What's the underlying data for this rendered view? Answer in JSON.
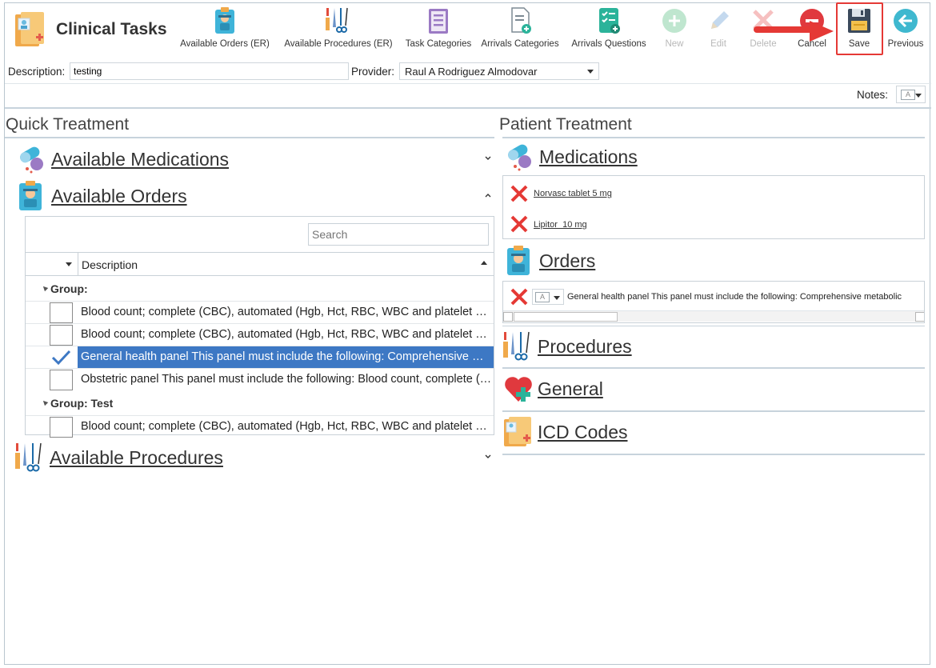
{
  "app": {
    "title": "Clinical Tasks"
  },
  "toolbar": {
    "buttons": [
      {
        "id": "available-orders-er",
        "label": "Available Orders (ER)",
        "icon": "orders-clipboard-icon",
        "enabled": true
      },
      {
        "id": "available-procedures-er",
        "label": "Available Procedures (ER)",
        "icon": "surgical-tools-icon",
        "enabled": true
      },
      {
        "id": "task-categories",
        "label": "Task Categories",
        "icon": "list-clipboard-icon",
        "enabled": true
      },
      {
        "id": "arrivals-categories",
        "label": "Arrivals Categories",
        "icon": "document-add-icon",
        "enabled": true
      },
      {
        "id": "arrivals-questions",
        "label": "Arrivals Questions",
        "icon": "checklist-icon",
        "enabled": true
      },
      {
        "id": "new",
        "label": "New",
        "icon": "plus-circle-icon",
        "enabled": false
      },
      {
        "id": "edit",
        "label": "Edit",
        "icon": "pencil-icon",
        "enabled": false
      },
      {
        "id": "delete",
        "label": "Delete",
        "icon": "delete-x-icon",
        "enabled": false
      },
      {
        "id": "cancel",
        "label": "Cancel",
        "icon": "cancel-circle-icon",
        "enabled": true
      },
      {
        "id": "save",
        "label": "Save",
        "icon": "floppy-disk-icon",
        "enabled": true
      },
      {
        "id": "previous",
        "label": "Previous",
        "icon": "arrow-left-circle-icon",
        "enabled": true
      }
    ]
  },
  "form": {
    "description_label": "Description:",
    "description_value": "testing",
    "provider_label": "Provider:",
    "provider_value": "Raul A Rodriguez Almodovar",
    "notes_label": "Notes:"
  },
  "quick_treatment": {
    "title": "Quick Treatment",
    "sections": {
      "medications": "Available Medications",
      "orders": "Available Orders",
      "procedures": "Available Procedures"
    },
    "grid": {
      "search_placeholder": "Search",
      "column_header": "Description",
      "groups": [
        {
          "label": "Group:",
          "rows": [
            {
              "text": "Blood count; complete (CBC), automated (Hgb, Hct, RBC, WBC and platelet count) and automated differential WBC count",
              "checked": false,
              "selected": false
            },
            {
              "text": "Blood count; complete (CBC), automated (Hgb, Hct, RBC, WBC and platelet count) and manual differential WBC count",
              "checked": false,
              "selected": false
            },
            {
              "text": "General health panel This panel must include the following: Comprehensive metabolic panel",
              "checked": true,
              "selected": true
            },
            {
              "text": "Obstetric panel This panel must include the following: Blood count, complete (CBC)",
              "checked": false,
              "selected": false
            }
          ]
        },
        {
          "label": "Group: Test",
          "rows": [
            {
              "text": "Blood count; complete (CBC), automated (Hgb, Hct, RBC, WBC and platelet count)",
              "checked": false,
              "selected": false
            }
          ]
        }
      ]
    }
  },
  "patient_treatment": {
    "title": "Patient Treatment",
    "sections": {
      "medications": "Medications",
      "orders": "Orders",
      "procedures": "Procedures",
      "general": "General",
      "icd_codes": "ICD Codes"
    },
    "medications": [
      {
        "name": "Norvasc tablet 5 mg"
      },
      {
        "name": "Lipitor  10 mg"
      }
    ],
    "orders": [
      {
        "text": "General health panel This panel must include the following: Comprehensive metabolic panel"
      }
    ]
  }
}
